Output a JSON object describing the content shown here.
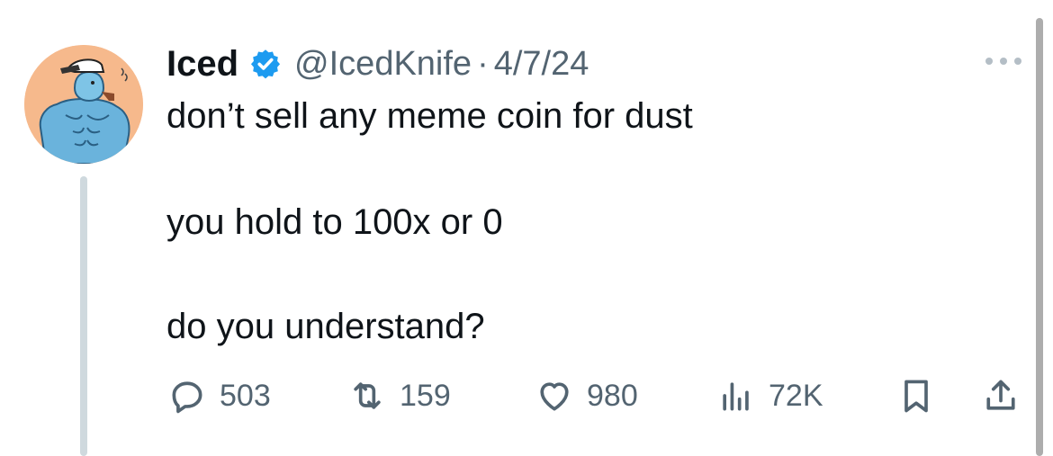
{
  "tweet": {
    "author_name": "Iced",
    "handle": "@IcedKnife",
    "separator": "·",
    "date": "4/7/24",
    "lines": [
      "don’t sell any meme coin for dust",
      "you hold to 100x or 0",
      "do you understand?"
    ]
  },
  "actions": {
    "replies": "503",
    "reposts": "159",
    "likes": "980",
    "views": "72K"
  },
  "colors": {
    "accent_blue": "#1d9bf0",
    "muted_text": "#536471",
    "thread_line": "#cfd9de",
    "avatar_bg": "#f6b98c"
  },
  "icons": {
    "verified": "verified-badge-icon",
    "more": "more-horizontal-icon",
    "reply": "reply-bubble-icon",
    "repost": "repost-arrows-icon",
    "like": "heart-icon",
    "views": "bar-chart-icon",
    "bookmark": "bookmark-icon",
    "share": "share-upload-icon"
  }
}
